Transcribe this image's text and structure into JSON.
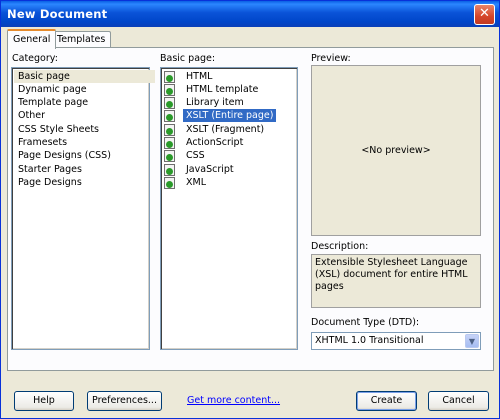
{
  "window": {
    "title": "New Document",
    "close_glyph": "✕"
  },
  "tabs": [
    {
      "label": "General",
      "active": true
    },
    {
      "label": "Templates",
      "active": false
    }
  ],
  "category": {
    "label": "Category:",
    "items": [
      "Basic page",
      "Dynamic page",
      "Template page",
      "Other",
      "CSS Style Sheets",
      "Framesets",
      "Page Designs (CSS)",
      "Starter Pages",
      "Page Designs"
    ],
    "selected": "Basic page"
  },
  "basic_page": {
    "label": "Basic page:",
    "items": [
      "HTML",
      "HTML template",
      "Library item",
      "XSLT (Entire page)",
      "XSLT (Fragment)",
      "ActionScript",
      "CSS",
      "JavaScript",
      "XML"
    ],
    "selected": "XSLT (Entire page)",
    "icon": "document-icon"
  },
  "preview": {
    "label": "Preview:",
    "placeholder": "<No preview>"
  },
  "description": {
    "label": "Description:",
    "text": "Extensible Stylesheet Language (XSL) document for entire HTML pages"
  },
  "doctype": {
    "label": "Document Type (DTD):",
    "value": "XHTML 1.0 Transitional"
  },
  "buttons": {
    "help": "Help",
    "preferences": "Preferences...",
    "get_more": "Get more content...",
    "create": "Create",
    "cancel": "Cancel"
  },
  "colors": {
    "selection": "#316ac5",
    "titlebar": "#0a53d8",
    "link": "#0000ff"
  }
}
